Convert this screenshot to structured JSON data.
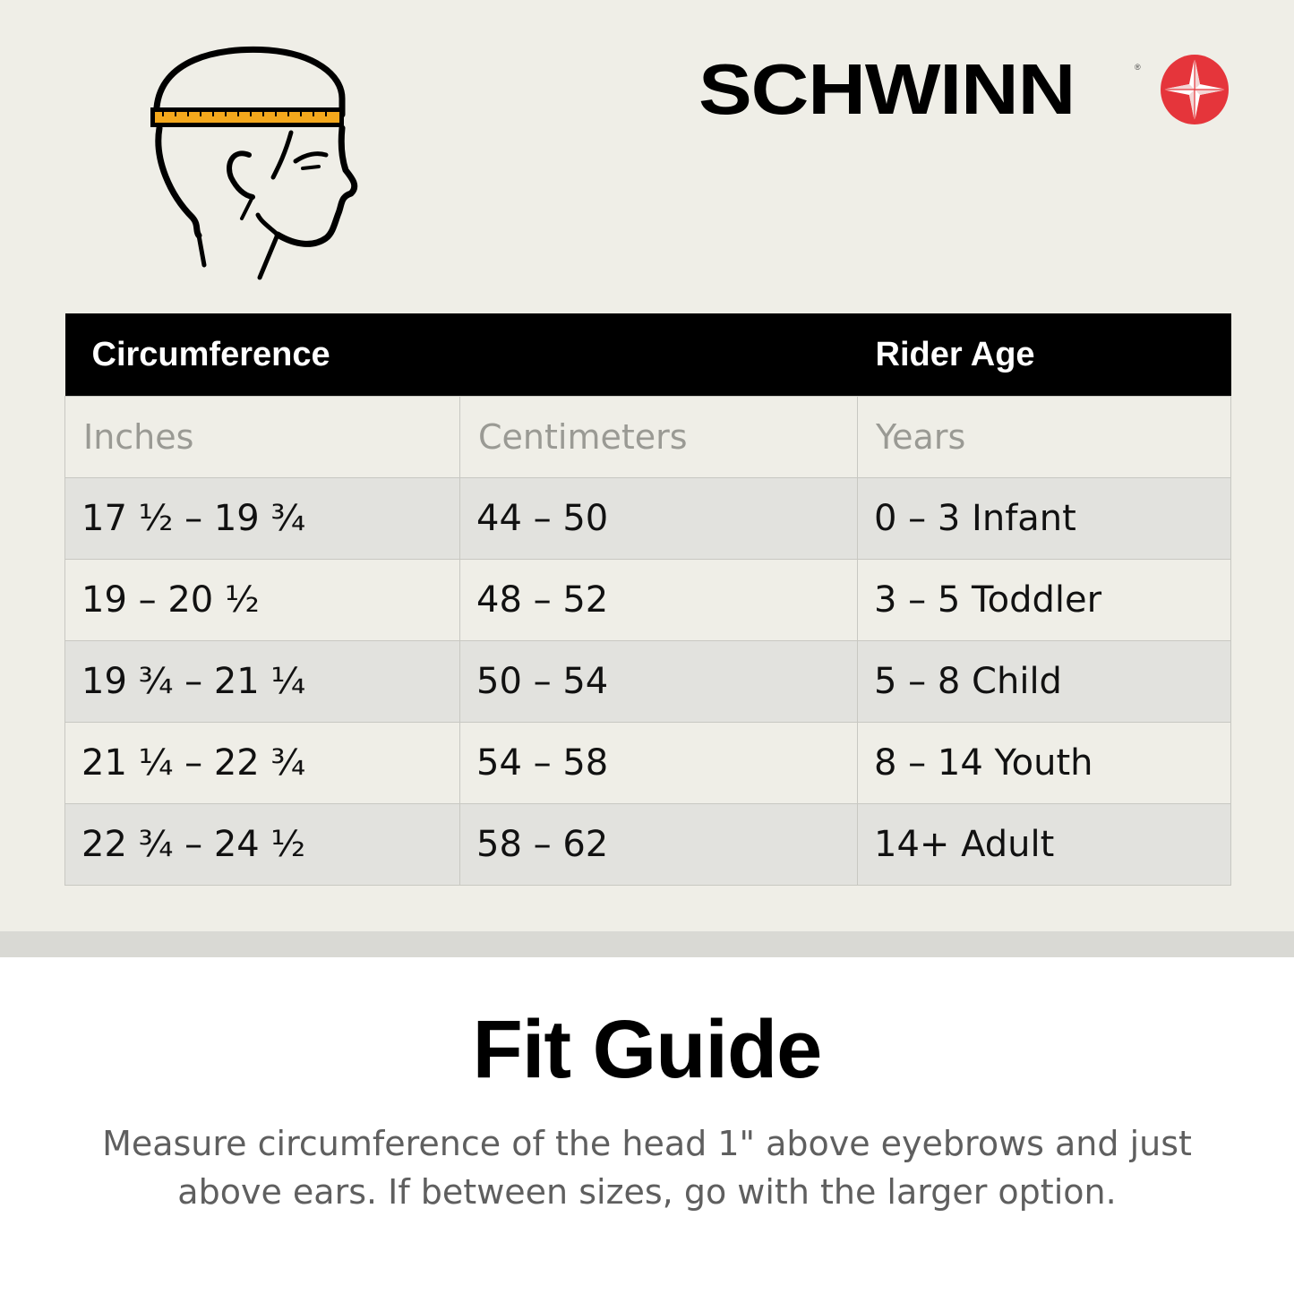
{
  "brand": {
    "name": "SCHWINN",
    "registered_mark": "®",
    "accent_color": "#e5353b"
  },
  "illustration": {
    "icon": "head-measuring-tape-icon",
    "tape_color": "#f4a81c"
  },
  "table": {
    "header": {
      "circumference": "Circumference",
      "rider_age": "Rider Age"
    },
    "units": {
      "inches": "Inches",
      "centimeters": "Centimeters",
      "years": "Years"
    },
    "rows": [
      {
        "inches": "17 ½  –  19 ¾",
        "cm": "44  –  50",
        "age": "0  –  3  Infant"
      },
      {
        "inches": "19  –  20 ½",
        "cm": "48  –  52",
        "age": "3  –  5 Toddler"
      },
      {
        "inches": "19 ¾  –  21 ¼",
        "cm": "50  –  54",
        "age": "5  –  8  Child"
      },
      {
        "inches": "21 ¼  –  22 ¾",
        "cm": "54  –  58",
        "age": "8  –  14  Youth"
      },
      {
        "inches": "22 ¾  –  24 ½",
        "cm": "58  –  62",
        "age": "14+  Adult"
      }
    ]
  },
  "footer": {
    "title": "Fit Guide",
    "description": "Measure circumference of the head 1\" above eyebrows and just above ears. If between sizes, go with the larger option."
  }
}
